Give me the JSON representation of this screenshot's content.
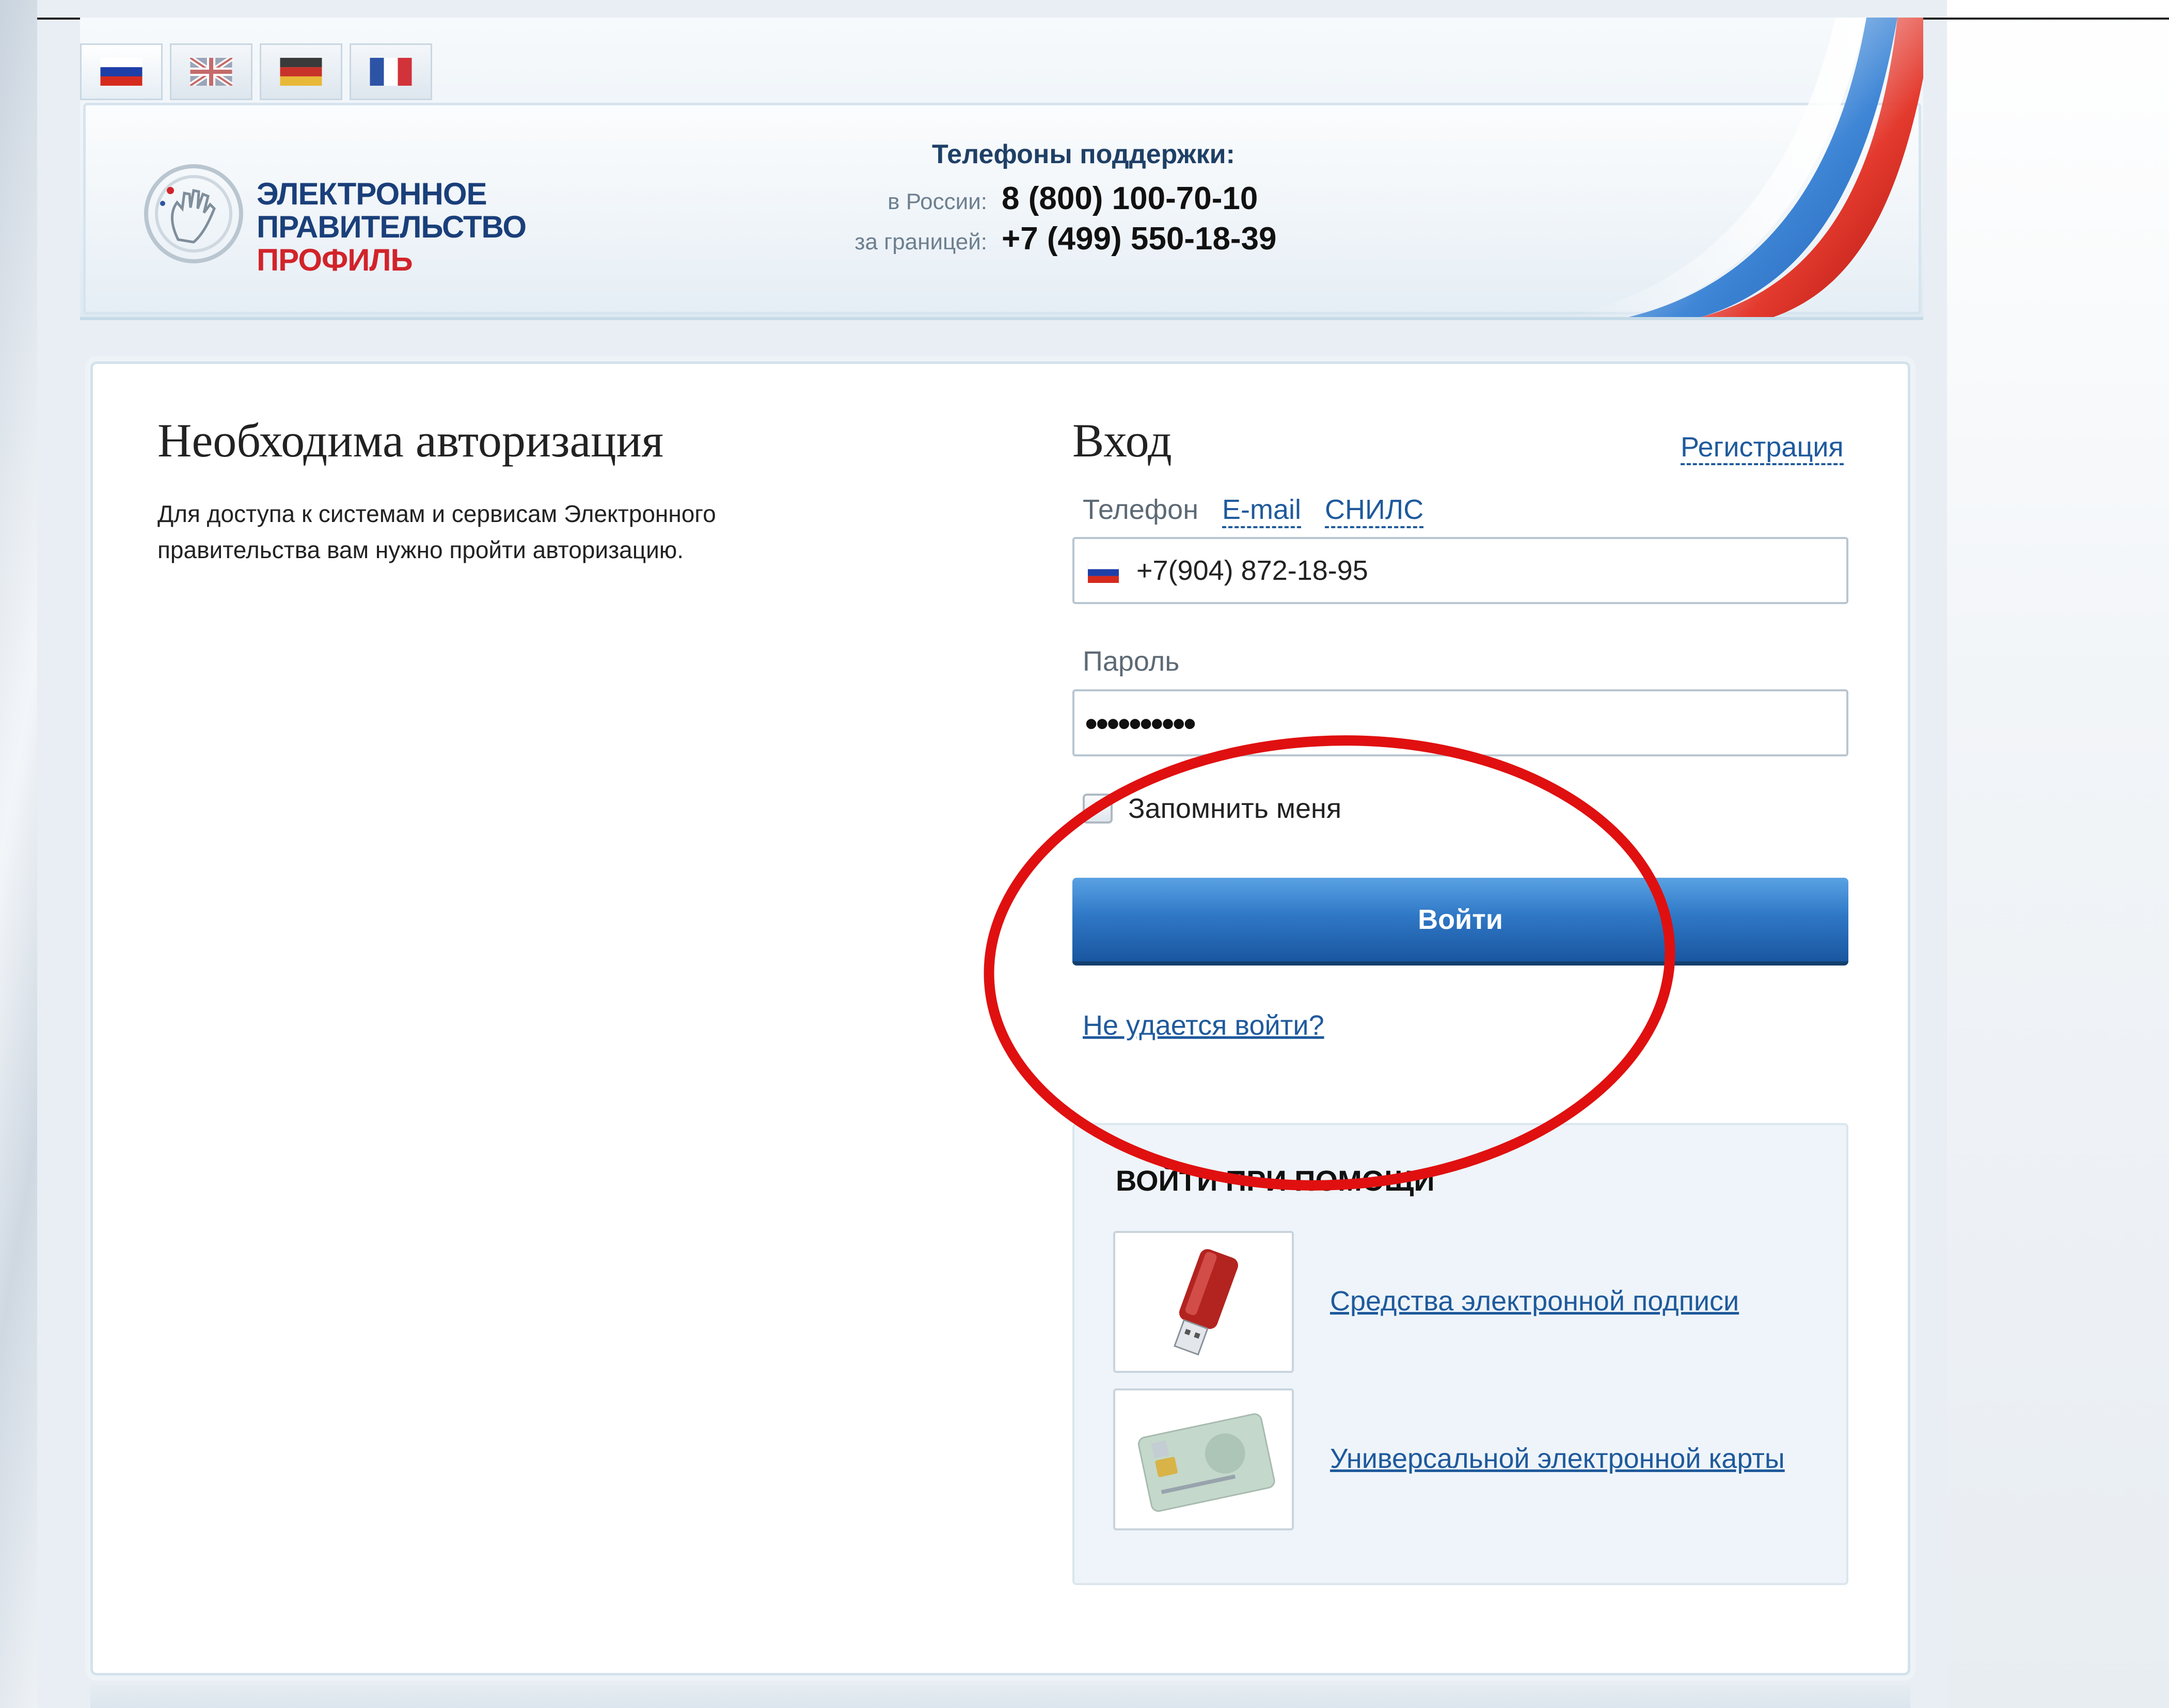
{
  "languages": [
    {
      "name": "russian-flag-icon",
      "active": true
    },
    {
      "name": "uk-flag-icon",
      "active": false
    },
    {
      "name": "german-flag-icon",
      "active": false
    },
    {
      "name": "french-flag-icon",
      "active": false
    }
  ],
  "logo": {
    "line1": "ЭЛЕКТРОННОЕ",
    "line2": "ПРАВИТЕЛЬСТВО",
    "line3": "ПРОФИЛЬ"
  },
  "support": {
    "title": "Телефоны поддержки:",
    "russia_label": "в России:",
    "russia_phone": "8 (800) 100-70-10",
    "abroad_label": "за границей:",
    "abroad_phone": "+7 (499) 550-18-39"
  },
  "auth": {
    "title": "Необходима авторизация",
    "desc_line1": "Для доступа к системам и сервисам Электронного",
    "desc_line2": "правительства вам нужно пройти авторизацию."
  },
  "login": {
    "title": "Вход",
    "register_link": "Регистрация",
    "tabs": [
      "Телефон",
      "E-mail",
      "СНИЛС"
    ],
    "phone_value": "+7(904) 872-18-95",
    "password_label": "Пароль",
    "password_value": "••••••••••",
    "remember_label": "Запомнить меня",
    "submit_label": "Войти",
    "forgot_link": "Не удается войти?"
  },
  "alt_login": {
    "title": "ВОЙТИ ПРИ ПОМОЩИ",
    "items": [
      {
        "label": "Средства электронной подписи",
        "icon": "usb-token-icon"
      },
      {
        "label": "Универсальной электронной карты",
        "icon": "smart-card-icon"
      }
    ]
  },
  "colors": {
    "brand_blue": "#1a3f7a",
    "brand_red": "#d2232a",
    "link_blue": "#1f5a9c",
    "annotation_red": "#e01010"
  }
}
